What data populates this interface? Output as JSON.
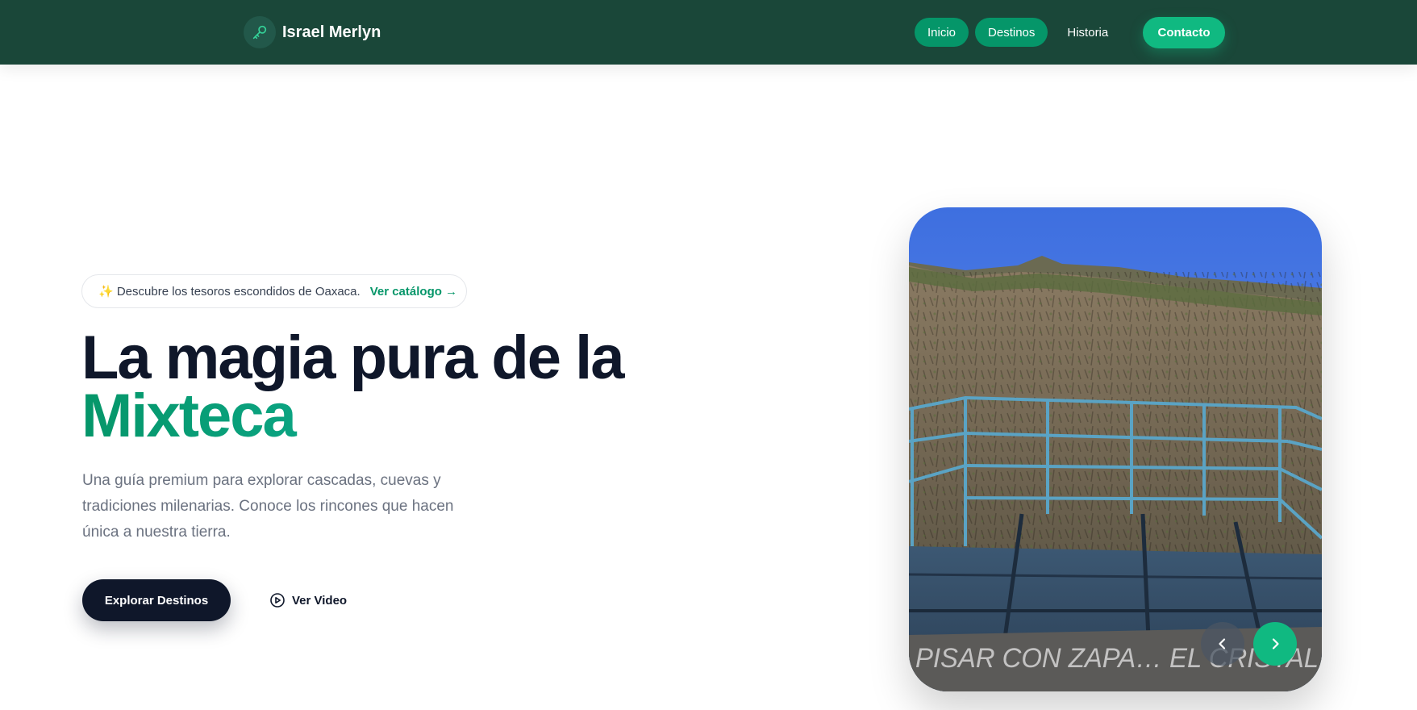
{
  "navbar": {
    "brand": "Israel Merlyn",
    "links": [
      {
        "label": "Inicio"
      },
      {
        "label": "Destinos"
      },
      {
        "label": "Historia"
      }
    ],
    "contact_label": "Contacto"
  },
  "hero": {
    "badge": {
      "text": "✨ Descubre los tesoros escondidos de Oaxaca.",
      "link": "Ver catálogo →"
    },
    "title_line1": "La magia pura de la",
    "title_accent": "Mixteca",
    "subtitle": "Una guía premium para explorar cascadas, cuevas y tradiciones milenarias. Conoce los rincones que hacen única a nuestra tierra.",
    "primary_button": "Explorar Destinos",
    "video_button": "Ver Video"
  },
  "carousel": {
    "photo_text": "PISAR CON ZAPA… EL CRISTAL"
  },
  "colors": {
    "nav_bg": "#1a4739",
    "accent": "#10b981",
    "accent_dark": "#059669",
    "dark": "#0f172a"
  }
}
